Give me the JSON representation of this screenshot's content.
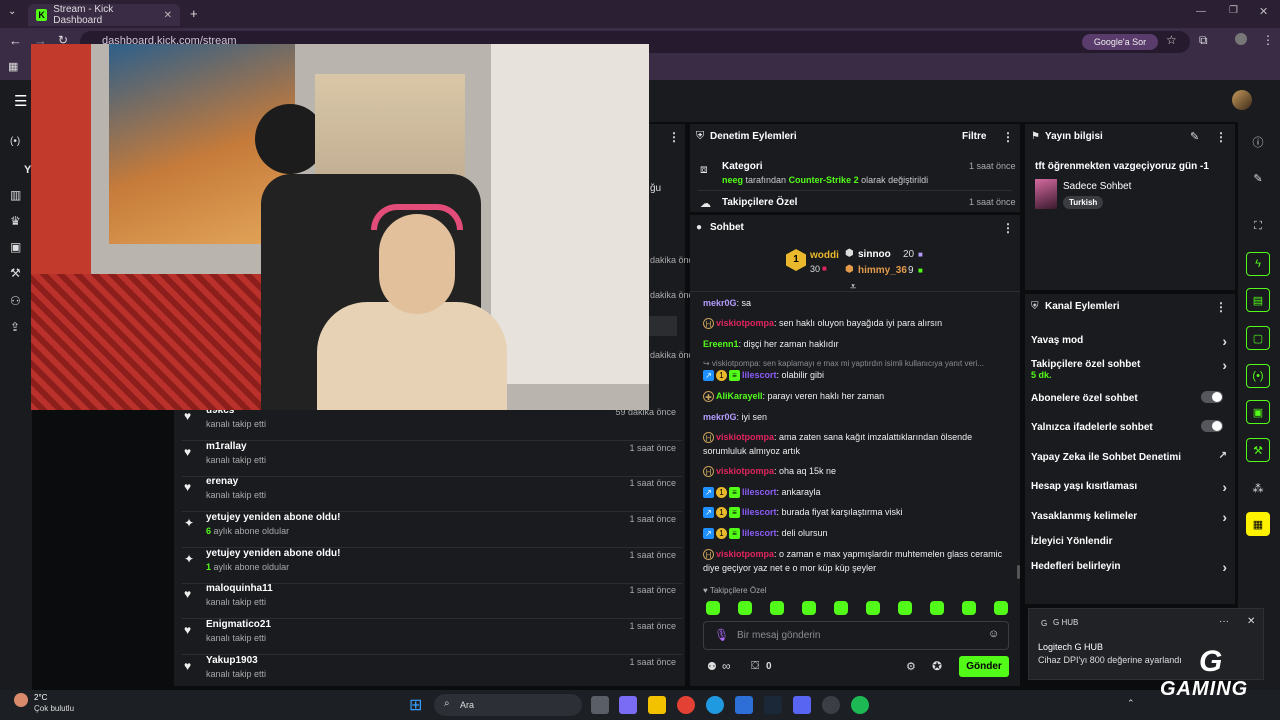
{
  "browser": {
    "tab_title": "Stream - Kick Dashboard",
    "url": "dashboard.kick.com/stream",
    "google_button": "Google'a Sor"
  },
  "panels": {
    "moderation_title": "Denetim Eylemleri",
    "moderation_filter": "Filtre",
    "chat_title": "Sohbet",
    "stream_info_title": "Yayın bilgisi",
    "channel_actions_title": "Kanal Eylemleri"
  },
  "moderation": [
    {
      "title": "Kategori",
      "time": "1 saat önce",
      "actor": "neeg",
      "pre": " tarafından ",
      "target": "Counter-Strike 2",
      "post": " olarak değiştirildi"
    },
    {
      "title": "Takipçilere Özel",
      "time": "1 saat önce"
    }
  ],
  "stream_info": {
    "title": "tft öğrenmekten vazgeçiyoruz gün -1",
    "category": "Sadece Sohbet",
    "tag": "Turkish"
  },
  "leaderboard": {
    "rank": "1",
    "first_name": "woddi",
    "first_value": "30",
    "second_name": "sinnoo",
    "second_value": "20",
    "third_name": "himmy_36",
    "third_value": "9"
  },
  "activity_partial": {
    "label_1": "ğu",
    "time_1": "dakika önce",
    "time_2": "dakika önce",
    "time_3": "dakika önce"
  },
  "activity": [
    {
      "name": "u9kcs",
      "sub": "kanalı takip etti",
      "time": "59 dakika önce",
      "icon": "heart"
    },
    {
      "name": "m1rallay",
      "sub": "kanalı takip etti",
      "time": "1 saat önce",
      "icon": "heart"
    },
    {
      "name": "erenay",
      "sub": "kanalı takip etti",
      "time": "1 saat önce",
      "icon": "heart"
    },
    {
      "name": "yetujey yeniden abone oldu!",
      "months": "6",
      "sub": " aylık abone oldular",
      "time": "1 saat önce",
      "icon": "sparkle"
    },
    {
      "name": "yetujey yeniden abone oldu!",
      "months": "1",
      "sub": " aylık abone oldular",
      "time": "1 saat önce",
      "icon": "sparkle"
    },
    {
      "name": "maloquinha11",
      "sub": "kanalı takip etti",
      "time": "1 saat önce",
      "icon": "heart"
    },
    {
      "name": "Enigmatico21",
      "sub": "kanalı takip etti",
      "time": "1 saat önce",
      "icon": "heart"
    },
    {
      "name": "Yakup1903",
      "sub": "kanalı takip etti",
      "time": "1 saat önce",
      "icon": "heart"
    }
  ],
  "chat": [
    {
      "user": "mekr0G",
      "color": "#b49cff",
      "text": ": sa"
    },
    {
      "user": "viskiotpompa",
      "color": "#e0245e",
      "text": ": sen haklı oluyon bayağıda iyi para alırsın"
    },
    {
      "user": "Ereenn1",
      "color": "#53fc18",
      "text": ": dişçi her zaman haklıdır"
    },
    {
      "reply": "↪ viskiotpompa: sen kaplamayı e max mi yaptırdın isimli kullanıcıya yanıt veri..."
    },
    {
      "user": "lilescort",
      "color": "#8b5cf6",
      "text": ": olabilir gibi"
    },
    {
      "user": "AliKarayell",
      "color": "#53fc18",
      "text": ": parayı veren haklı her zaman"
    },
    {
      "user": "mekr0G",
      "color": "#b49cff",
      "text": ": iyi sen"
    },
    {
      "user": "viskiotpompa",
      "color": "#e0245e",
      "text": ": ama zaten sana kağıt imzalattıklarından ölsende sorumluluk almıyoz artık"
    },
    {
      "user": "viskiotpompa",
      "color": "#e0245e",
      "text": ": oha aq 15k ne"
    },
    {
      "user": "lilescort",
      "color": "#8b5cf6",
      "text": ": ankarayla"
    },
    {
      "user": "lilescort",
      "color": "#8b5cf6",
      "text": ": burada fiyat karşılaştırma viski"
    },
    {
      "user": "lilescort",
      "color": "#8b5cf6",
      "text": ": deli olursun"
    },
    {
      "user": "viskiotpompa",
      "color": "#e0245e",
      "text": ": o zaman e max yapmışlardır muhtemelen glass ceramic diye geçiyor yaz net e o mor küp küp şeyler"
    }
  ],
  "chat_footer": {
    "followers_only": "Takipçilere Özel",
    "placeholder": "Bir mesaj gönderin",
    "infinity": "∞",
    "count": "0",
    "send": "Gönder"
  },
  "channel_actions": [
    {
      "label": "Yavaş mod",
      "control": "chevron"
    },
    {
      "label": "Takipçilere özel sohbet",
      "sub": "5 dk.",
      "control": "chevron"
    },
    {
      "label": "Abonelere özel sohbet",
      "control": "toggle"
    },
    {
      "label": "Yalnızca ifadelerle sohbet",
      "control": "toggle"
    },
    {
      "label": "Yapay Zeka ile Sohbet Denetimi",
      "control": "external"
    },
    {
      "label": "Hesap yaşı kısıtlaması",
      "control": "chevron"
    },
    {
      "label": "Yasaklanmış kelimeler",
      "control": "chevron"
    },
    {
      "label": "İzleyici Yönlendir",
      "control": "none"
    },
    {
      "label": "Hedefleri belirleyin",
      "control": "chevron"
    }
  ],
  "notification": {
    "app": "G HUB",
    "title": "Logitech G HUB",
    "body": "Cihaz DPI'yı 800 değerine ayarlandı",
    "logo_text": "GAMING"
  },
  "taskbar": {
    "temp": "2°C",
    "weather": "Çok bulutlu",
    "search": "Ara"
  },
  "colors": {
    "accent": "#53fc18",
    "panel": "#191b1f",
    "background": "#0b0c0e"
  }
}
